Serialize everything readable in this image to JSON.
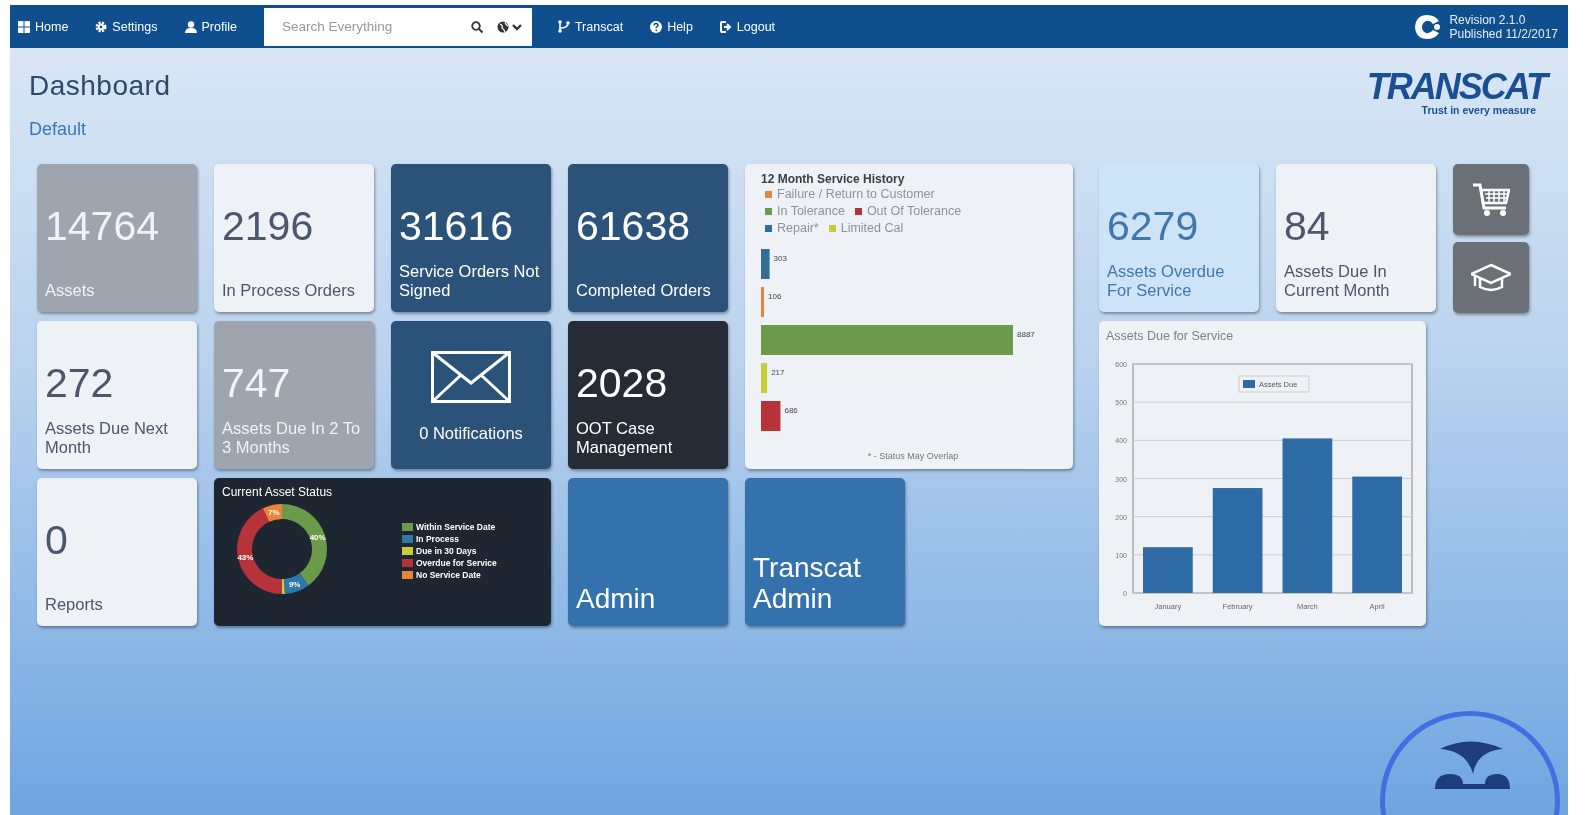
{
  "navbar": {
    "items": [
      {
        "kind": "home",
        "label": "Home"
      },
      {
        "kind": "settings",
        "label": "Settings"
      },
      {
        "kind": "profile",
        "label": "Profile"
      }
    ],
    "search": {
      "placeholder": "Search Everything"
    },
    "links": [
      {
        "kind": "transcat",
        "label": "Transcat"
      },
      {
        "kind": "help",
        "label": "Help"
      },
      {
        "kind": "logout",
        "label": "Logout"
      }
    ],
    "revision": "Revision 2.1.0",
    "published": "Published 11/2/2017"
  },
  "header": {
    "title": "Dashboard",
    "subtitle": "Default",
    "brand": "TRANSCAT",
    "tagline": "Trust in every measure"
  },
  "tiles": [
    {
      "kind": "stat",
      "color": "#9ea5ae",
      "value": "14764",
      "label": "Assets"
    },
    {
      "kind": "stat",
      "color": "#eef1f6",
      "value": "2196",
      "label": "In Process Orders"
    },
    {
      "kind": "stat",
      "color": "#2b5279",
      "value": "31616",
      "label": "Service Orders Not Signed"
    },
    {
      "kind": "stat",
      "color": "#2b5279",
      "value": "61638",
      "label": "Completed Orders"
    },
    {
      "kind": "history",
      "title": "12 Month Service History",
      "legend": [
        {
          "label": "Failure / Return to Customer",
          "color": "#e8833a"
        },
        {
          "label": "In Tolerance",
          "color": "#6a9a4a"
        },
        {
          "label": "Out Of Tolerance",
          "color": "#b8323a"
        },
        {
          "label": "Repair*",
          "color": "#336d96"
        },
        {
          "label": "Limited Cal",
          "color": "#c8cc3a"
        }
      ],
      "chart_data": {
        "type": "bar",
        "orientation": "horizontal",
        "values": [
          303,
          106,
          8887,
          217,
          686
        ],
        "colors": [
          "#336d96",
          "#e8833a",
          "#6a9a4a",
          "#c8cc3a",
          "#b8323a"
        ],
        "data_labels": true
      },
      "footnote": "* - Status May Overlap"
    },
    {
      "kind": "stat",
      "color": "#eef1f6",
      "value": "272",
      "label": "Assets Due Next Month"
    },
    {
      "kind": "stat",
      "color": "#9ea5ae",
      "value": "747",
      "label": "Assets Due In 2 To 3 Months"
    },
    {
      "kind": "notice",
      "color": "#2b5279",
      "label": "0 Notifications"
    },
    {
      "kind": "stat",
      "color": "#252c36",
      "value": "2028",
      "label": "OOT Case Management"
    },
    {
      "kind": "stat",
      "color": "#eef1f6",
      "value": "0",
      "label": "Reports"
    },
    {
      "kind": "donut",
      "title": "Current Asset Status",
      "chart_data": {
        "type": "donut",
        "categories": [
          "Within Service Date",
          "In Process",
          "Due in 30 Days",
          "Overdue for Service",
          "No Service Date"
        ],
        "values": [
          40,
          9,
          1,
          43,
          7
        ],
        "colors": [
          "#6a9a4a",
          "#2f77a8",
          "#c8cc3a",
          "#b8323a",
          "#e8833a"
        ],
        "value_labels": [
          "40%",
          "9%",
          null,
          "43%",
          "7%"
        ]
      }
    },
    {
      "kind": "link",
      "color": "#3472ad",
      "label": "Admin"
    },
    {
      "kind": "link",
      "color": "#3472ad",
      "label": "Transcat Admin"
    }
  ],
  "right_tiles": [
    {
      "kind": "stat",
      "color": "#cde3f8",
      "value": "6279",
      "label": "Assets Overdue For Service"
    },
    {
      "kind": "stat",
      "color": "#eef1f6",
      "value": "84",
      "label": "Assets Due In Current Month"
    },
    {
      "kind": "column",
      "title": "Assets Due for Service",
      "chart_data": {
        "type": "bar",
        "categories": [
          "January",
          "February",
          "March",
          "April"
        ],
        "series": [
          {
            "name": "Assets Due",
            "color": "#2f6ca6",
            "values": [
              120,
              275,
              405,
              305
            ]
          }
        ],
        "ylim": [
          0,
          600
        ],
        "yticks": [
          0,
          100,
          200,
          300,
          400,
          500,
          600
        ],
        "grid": true
      }
    }
  ],
  "shortcuts": [
    {
      "kind": "cart"
    },
    {
      "kind": "cap"
    }
  ]
}
